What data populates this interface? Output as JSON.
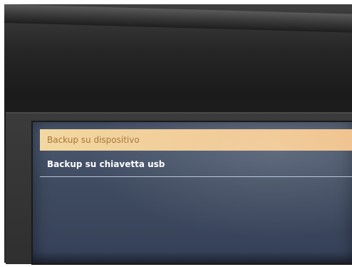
{
  "screen": {
    "menu": [
      {
        "label": "Backup su dispositivo",
        "selected": true
      },
      {
        "label": "Backup su chiavetta usb",
        "selected": false
      }
    ]
  },
  "colors": {
    "selected_bg": "#f0c992",
    "selected_text": "#a8743d",
    "screen_bg": "#3f4b60",
    "normal_text": "#ffffff"
  }
}
